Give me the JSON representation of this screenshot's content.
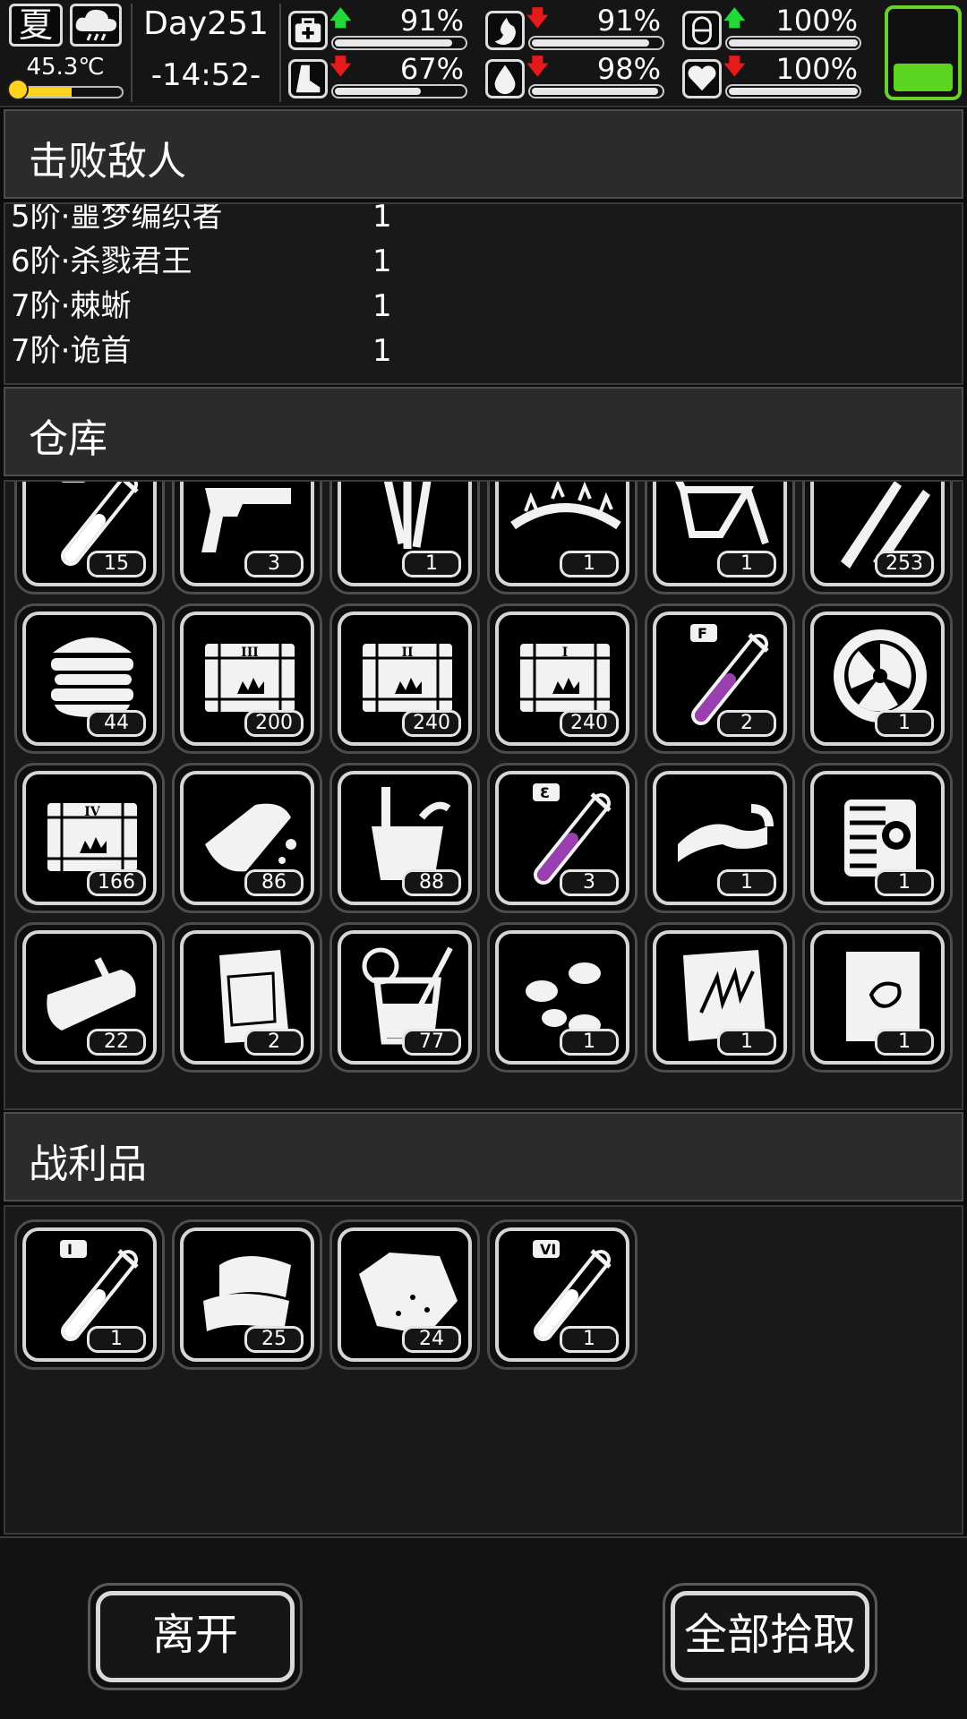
{
  "hud": {
    "season": "夏",
    "weather_icon": "rain-cloud-icon",
    "temperature": "45.3℃",
    "temperature_level": 0.55,
    "day": "Day251",
    "time": "-14:52-",
    "stats": [
      {
        "icon": "medkit-icon",
        "trend": "up",
        "trend_glyph": "🡅",
        "value": "91%",
        "level": 0.91
      },
      {
        "icon": "stomach-icon",
        "trend": "down",
        "trend_glyph": "🡇",
        "value": "91%",
        "level": 0.91
      },
      {
        "icon": "capsule-icon",
        "trend": "up",
        "trend_glyph": "🡅",
        "value": "100%",
        "level": 1.0
      },
      {
        "icon": "foot-icon",
        "trend": "down",
        "trend_glyph": "🡇",
        "value": "67%",
        "level": 0.67
      },
      {
        "icon": "water-drop-icon",
        "trend": "down",
        "trend_glyph": "🡇",
        "value": "98%",
        "level": 0.98
      },
      {
        "icon": "heart-icon",
        "trend": "down",
        "trend_glyph": "🡇",
        "value": "100%",
        "level": 1.0
      }
    ],
    "battery_level": 0.38,
    "colors": {
      "up": "#22d83a",
      "down": "#e51a1a",
      "battery": "#5bd51f",
      "temp": "#ffd21f"
    }
  },
  "sections": {
    "defeated": "击败敌人",
    "warehouse": "仓库",
    "loot": "战利品"
  },
  "defeated_enemies": [
    {
      "name": "5阶·噩梦编织者",
      "count": "1"
    },
    {
      "name": "6阶·杀戮君王",
      "count": "1"
    },
    {
      "name": "7阶·棘蜥",
      "count": "1"
    },
    {
      "name": "7阶·诡首",
      "count": "1"
    }
  ],
  "warehouse_items": [
    {
      "icon": "test-tube-v-icon",
      "count": "15"
    },
    {
      "icon": "pistol-icon",
      "count": "3"
    },
    {
      "icon": "metal-rods-icon",
      "count": "1"
    },
    {
      "icon": "spiked-chain-icon",
      "count": "1"
    },
    {
      "icon": "bike-frame-icon",
      "count": "1"
    },
    {
      "icon": "bullets-icon",
      "count": "253"
    },
    {
      "icon": "burger-stack-icon",
      "count": "44"
    },
    {
      "icon": "crate-iii-icon",
      "count": "200"
    },
    {
      "icon": "crate-ii-icon",
      "count": "240"
    },
    {
      "icon": "crate-i-icon",
      "count": "240"
    },
    {
      "icon": "test-tube-f-icon",
      "count": "2"
    },
    {
      "icon": "saw-blade-icon",
      "count": "1"
    },
    {
      "icon": "crate-iv-icon",
      "count": "166"
    },
    {
      "icon": "bread-icon",
      "count": "86"
    },
    {
      "icon": "bucket-icon",
      "count": "88"
    },
    {
      "icon": "test-tube-e-icon",
      "count": "3"
    },
    {
      "icon": "bike-seat-icon",
      "count": "1"
    },
    {
      "icon": "engine-icon",
      "count": "1"
    },
    {
      "icon": "sardine-can-icon",
      "count": "22"
    },
    {
      "icon": "food-pouch-icon",
      "count": "2"
    },
    {
      "icon": "lemonade-icon",
      "count": "77"
    },
    {
      "icon": "pills-icon",
      "count": "1"
    },
    {
      "icon": "blueprint-spikes-icon",
      "count": "1"
    },
    {
      "icon": "blueprint-scroll-icon",
      "count": "1"
    }
  ],
  "loot_items": [
    {
      "icon": "test-tube-i-icon",
      "count": "1"
    },
    {
      "icon": "cloth-icon",
      "count": "25"
    },
    {
      "icon": "ore-chunk-icon",
      "count": "24"
    },
    {
      "icon": "test-tube-vi-icon",
      "count": "1"
    }
  ],
  "buttons": {
    "leave": "离开",
    "take_all": "全部拾取"
  }
}
